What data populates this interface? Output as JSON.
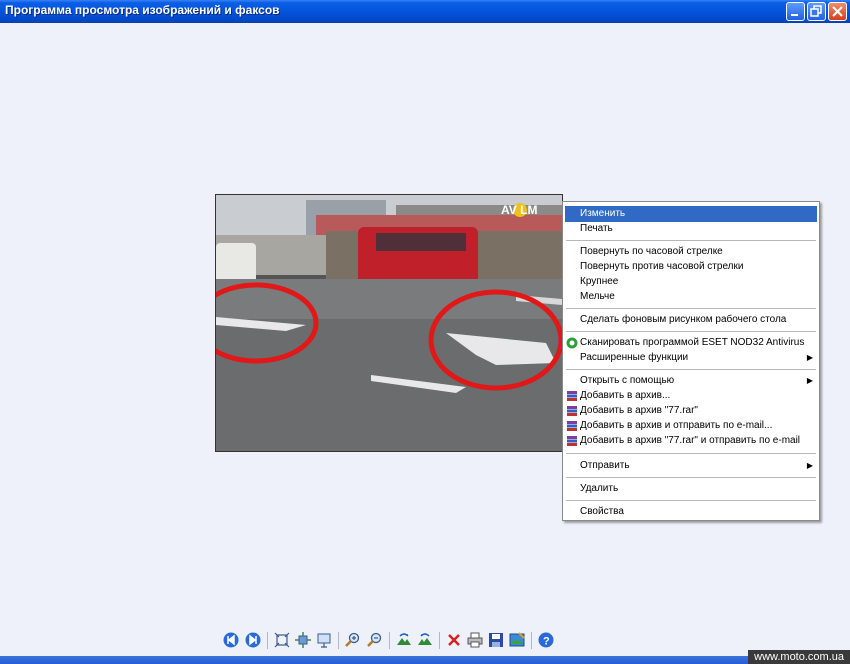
{
  "window": {
    "title": "Программа просмотра изображений и факсов"
  },
  "photo": {
    "logo_text": "AV LM"
  },
  "context_menu": {
    "items": [
      {
        "label": "Изменить",
        "highlighted": true
      },
      {
        "label": "Печать"
      },
      {
        "label": "Повернуть по часовой стрелке"
      },
      {
        "label": "Повернуть против часовой стрелки"
      },
      {
        "label": "Крупнее"
      },
      {
        "label": "Мельче"
      },
      {
        "label": "Сделать фоновым рисунком рабочего стола"
      },
      {
        "label": "Сканировать программой ESET NOD32 Antivirus",
        "icon": "eset-icon"
      },
      {
        "label": "Расширенные функции",
        "submenu": true
      },
      {
        "label": "Открыть с помощью",
        "submenu": true
      },
      {
        "label": "Добавить в архив...",
        "icon": "winrar-icon"
      },
      {
        "label": "Добавить в архив \"77.rar\"",
        "icon": "winrar-icon"
      },
      {
        "label": "Добавить в архив и отправить по e-mail...",
        "icon": "winrar-icon"
      },
      {
        "label": "Добавить в архив \"77.rar\" и отправить по e-mail",
        "icon": "winrar-icon"
      },
      {
        "label": "Отправить",
        "submenu": true
      },
      {
        "label": "Удалить"
      },
      {
        "label": "Свойства"
      }
    ],
    "submenu_arrow": "▶"
  },
  "toolbar": {
    "buttons": [
      "previous-image-icon",
      "next-image-icon",
      "best-fit-icon",
      "actual-size-icon",
      "slideshow-icon",
      "zoom-in-icon",
      "zoom-out-icon",
      "rotate-clockwise-icon",
      "rotate-counterclockwise-icon",
      "delete-icon",
      "print-icon",
      "save-icon",
      "open-editor-icon",
      "help-icon"
    ]
  },
  "watermark": "www.moto.com.ua",
  "colors": {
    "title_bar": "#0554dc",
    "highlight": "#316ac5",
    "background": "#eef1f9"
  }
}
